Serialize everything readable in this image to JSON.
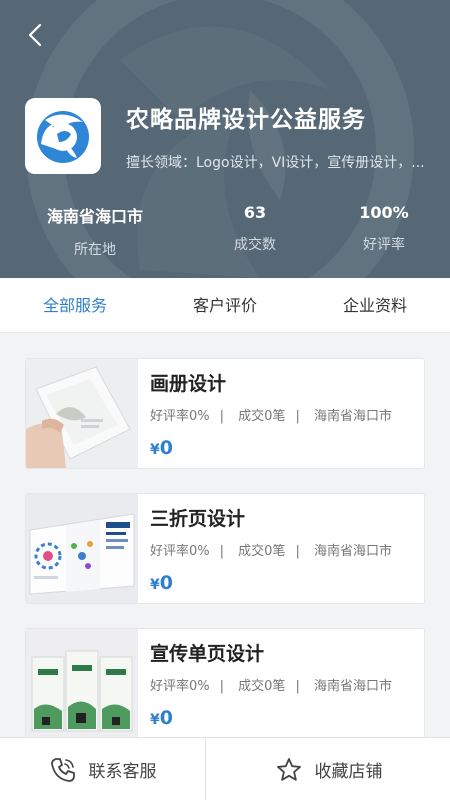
{
  "shop": {
    "name": "农略品牌设计公益服务",
    "specialty": "擅长领域：Logo设计，VI设计，宣传册设计，...",
    "stats": [
      {
        "value": "海南省海口市",
        "label": "所在地"
      },
      {
        "value": "63",
        "label": "成交数"
      },
      {
        "value": "100%",
        "label": "好评率"
      }
    ]
  },
  "tabs": [
    "全部服务",
    "客户评价",
    "企业资料"
  ],
  "services": [
    {
      "title": "画册设计",
      "rating": "好评率0%",
      "deals": "成交0笔",
      "location": "海南省海口市",
      "currency": "¥",
      "price": "0"
    },
    {
      "title": "三折页设计",
      "rating": "好评率0%",
      "deals": "成交0笔",
      "location": "海南省海口市",
      "currency": "¥",
      "price": "0"
    },
    {
      "title": "宣传单页设计",
      "rating": "好评率0%",
      "deals": "成交0笔",
      "location": "海南省海口市",
      "currency": "¥",
      "price": "0"
    }
  ],
  "meta_separator": "|",
  "bottom_bar": {
    "contact": "联系客服",
    "favorite": "收藏店铺"
  },
  "icons": {
    "back": "chevron-left-icon",
    "contact": "phone-icon",
    "favorite": "star-outline-icon"
  },
  "colors": {
    "header_bg": "#566875",
    "accent": "#2f7fd1"
  }
}
